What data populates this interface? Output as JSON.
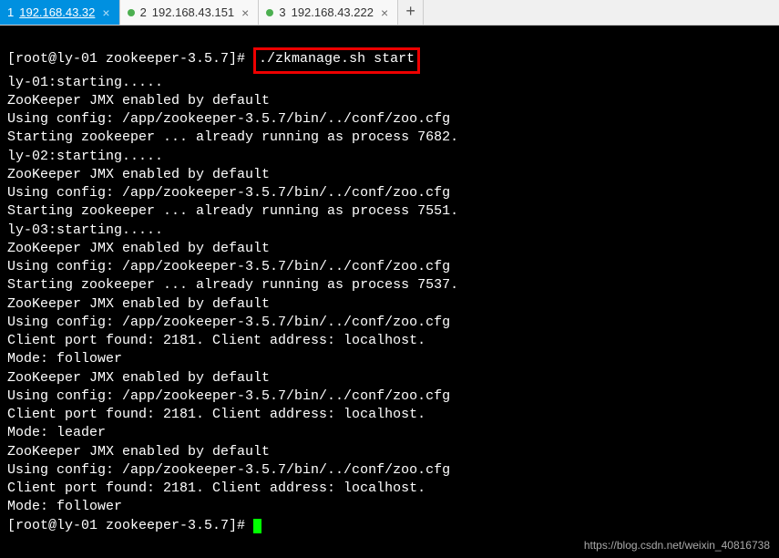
{
  "tabs": [
    {
      "index": "1",
      "label": "192.168.43.32",
      "active": true
    },
    {
      "index": "2",
      "label": "192.168.43.151",
      "active": false
    },
    {
      "index": "3",
      "label": "192.168.43.222",
      "active": false
    }
  ],
  "prompt1": {
    "text": "[root@ly-01 zookeeper-3.5.7]# ",
    "command": "./zkmanage.sh start"
  },
  "output_lines": [
    "ly-01:starting.....",
    "ZooKeeper JMX enabled by default",
    "Using config: /app/zookeeper-3.5.7/bin/../conf/zoo.cfg",
    "Starting zookeeper ... already running as process 7682.",
    "ly-02:starting.....",
    "ZooKeeper JMX enabled by default",
    "Using config: /app/zookeeper-3.5.7/bin/../conf/zoo.cfg",
    "Starting zookeeper ... already running as process 7551.",
    "ly-03:starting.....",
    "ZooKeeper JMX enabled by default",
    "Using config: /app/zookeeper-3.5.7/bin/../conf/zoo.cfg",
    "Starting zookeeper ... already running as process 7537.",
    "ZooKeeper JMX enabled by default",
    "Using config: /app/zookeeper-3.5.7/bin/../conf/zoo.cfg",
    "Client port found: 2181. Client address: localhost.",
    "Mode: follower",
    "ZooKeeper JMX enabled by default",
    "Using config: /app/zookeeper-3.5.7/bin/../conf/zoo.cfg",
    "Client port found: 2181. Client address: localhost.",
    "Mode: leader",
    "ZooKeeper JMX enabled by default",
    "Using config: /app/zookeeper-3.5.7/bin/../conf/zoo.cfg",
    "Client port found: 2181. Client address: localhost.",
    "Mode: follower"
  ],
  "prompt2": {
    "text": "[root@ly-01 zookeeper-3.5.7]# "
  },
  "watermark": "https://blog.csdn.net/weixin_40816738"
}
